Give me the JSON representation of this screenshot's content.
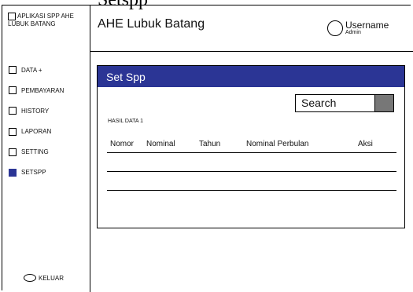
{
  "page": {
    "heading": "Setspp"
  },
  "app": {
    "title": "APLIKASI SPP AHE LUBUK BATANG"
  },
  "sidebar": {
    "items": [
      {
        "label": "DATA +",
        "active": false
      },
      {
        "label": "PEMBAYARAN",
        "active": false
      },
      {
        "label": "HISTORY",
        "active": false
      },
      {
        "label": "LAPORAN",
        "active": false
      },
      {
        "label": "SETTING",
        "active": false
      },
      {
        "label": "SETSPP",
        "active": true
      }
    ],
    "logout_label": "KELUAR"
  },
  "header": {
    "title": "AHE Lubuk Batang",
    "username": "Username",
    "role": "Admin"
  },
  "panel": {
    "title": "Set Spp",
    "search_label": "Search",
    "section_label": "HASIL DATA 1",
    "columns": [
      "Nomor",
      "Nominal",
      "Tahun",
      "Nominal Perbulan",
      "Aksi"
    ]
  },
  "colors": {
    "accent": "#2b3595",
    "search_button": "#777777"
  }
}
